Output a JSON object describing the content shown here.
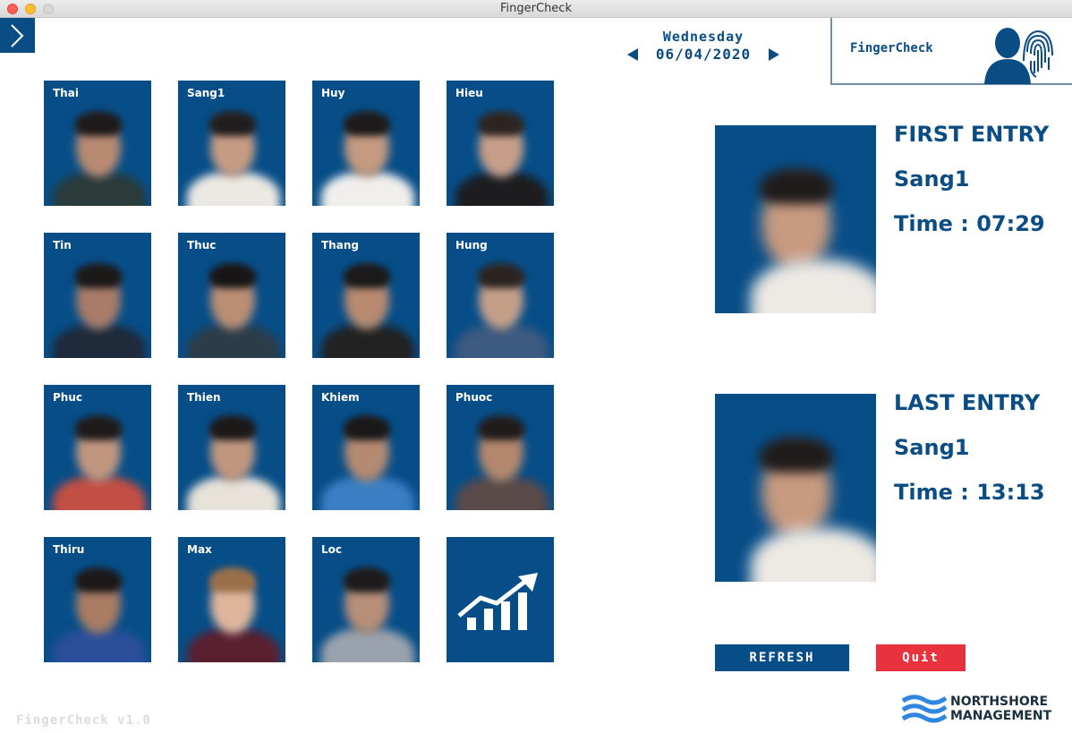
{
  "window": {
    "title": "FingerCheck"
  },
  "header": {
    "day": "Wednesday",
    "date": "06/04/2020",
    "brand": "FingerCheck"
  },
  "employees": [
    {
      "name": "Thai",
      "skin": "#b98a72",
      "hair": "#1e1a1a",
      "shirt": "#2a3b3a"
    },
    {
      "name": "Sang1",
      "skin": "#c59c83",
      "hair": "#221d1d",
      "shirt": "#ece9e4"
    },
    {
      "name": "Huy",
      "skin": "#c49a80",
      "hair": "#1d1a1a",
      "shirt": "#f0efed"
    },
    {
      "name": "Hieu",
      "skin": "#c79e88",
      "hair": "#2b2522",
      "shirt": "#1d1d1f"
    },
    {
      "name": "Tin",
      "skin": "#a87c68",
      "hair": "#1b1818",
      "shirt": "#1f2a3a"
    },
    {
      "name": "Thuc",
      "skin": "#bb8e74",
      "hair": "#171515",
      "shirt": "#2c3d4a"
    },
    {
      "name": "Thang",
      "skin": "#b88a70",
      "hair": "#1b1919",
      "shirt": "#222222"
    },
    {
      "name": "Hung",
      "skin": "#c49f88",
      "hair": "#2a2320",
      "shirt": "#3d5a80"
    },
    {
      "name": "Phuc",
      "skin": "#c1967f",
      "hair": "#1e1a1a",
      "shirt": "#c24f43"
    },
    {
      "name": "Thien",
      "skin": "#c0977e",
      "hair": "#1b1818",
      "shirt": "#e7e2da"
    },
    {
      "name": "Khiem",
      "skin": "#b48a72",
      "hair": "#1a1717",
      "shirt": "#3a7fc4"
    },
    {
      "name": "Phuoc",
      "skin": "#b3876d",
      "hair": "#201c1c",
      "shirt": "#5a4a4a"
    },
    {
      "name": "Thiru",
      "skin": "#a97c63",
      "hair": "#1b1818",
      "shirt": "#2b4f9a"
    },
    {
      "name": "Max",
      "skin": "#dfb69c",
      "hair": "#9a6e48",
      "shirt": "#5a2030"
    },
    {
      "name": "Loc",
      "skin": "#b78e78",
      "hair": "#1d1a1a",
      "shirt": "#9aa2ad"
    }
  ],
  "stats_tile": {
    "icon": "growth-chart-icon"
  },
  "first_entry": {
    "title": "FIRST ENTRY",
    "name": "Sang1",
    "time": "Time : 07:29"
  },
  "last_entry": {
    "title": "LAST ENTRY",
    "name": "Sang1",
    "time": "Time : 13:13"
  },
  "buttons": {
    "refresh": "REFRESH",
    "quit": "Quit"
  },
  "footer": {
    "version": "FingerCheck v1.0",
    "company_line1": "NORTHSHORE",
    "company_line2": "MANAGEMENT"
  },
  "colors": {
    "primary": "#0a4d85",
    "tile": "#074e88",
    "quit": "#e8323e"
  }
}
